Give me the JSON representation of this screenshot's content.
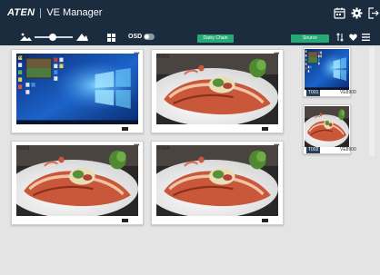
{
  "header": {
    "logo": "ATEN",
    "title": "VE Manager",
    "icons": [
      "calendar-icon",
      "gear-icon",
      "logout-icon"
    ]
  },
  "toolbar": {
    "osd_label": "OSD",
    "osd_enabled": false,
    "daisy_chain_label": "Daisy Chain",
    "source_label": "Source",
    "zoom_level": 0.4
  },
  "receivers": [
    {
      "id": "R001",
      "menu": "•••",
      "content": "desktop"
    },
    {
      "id": "R002",
      "menu": "•••",
      "content": "food"
    },
    {
      "id": "R003",
      "menu": "•••",
      "content": "food"
    },
    {
      "id": "R004",
      "menu": "•••",
      "content": "food"
    }
  ],
  "sources": [
    {
      "id": "T001",
      "model": "VE8900",
      "content": "desktop"
    },
    {
      "id": "T002",
      "model": "VE8900",
      "content": "food"
    }
  ],
  "colors": {
    "header_bg": "#1c2c3f",
    "accent_green": "#27a974",
    "page_bg": "#e4e4e4"
  }
}
